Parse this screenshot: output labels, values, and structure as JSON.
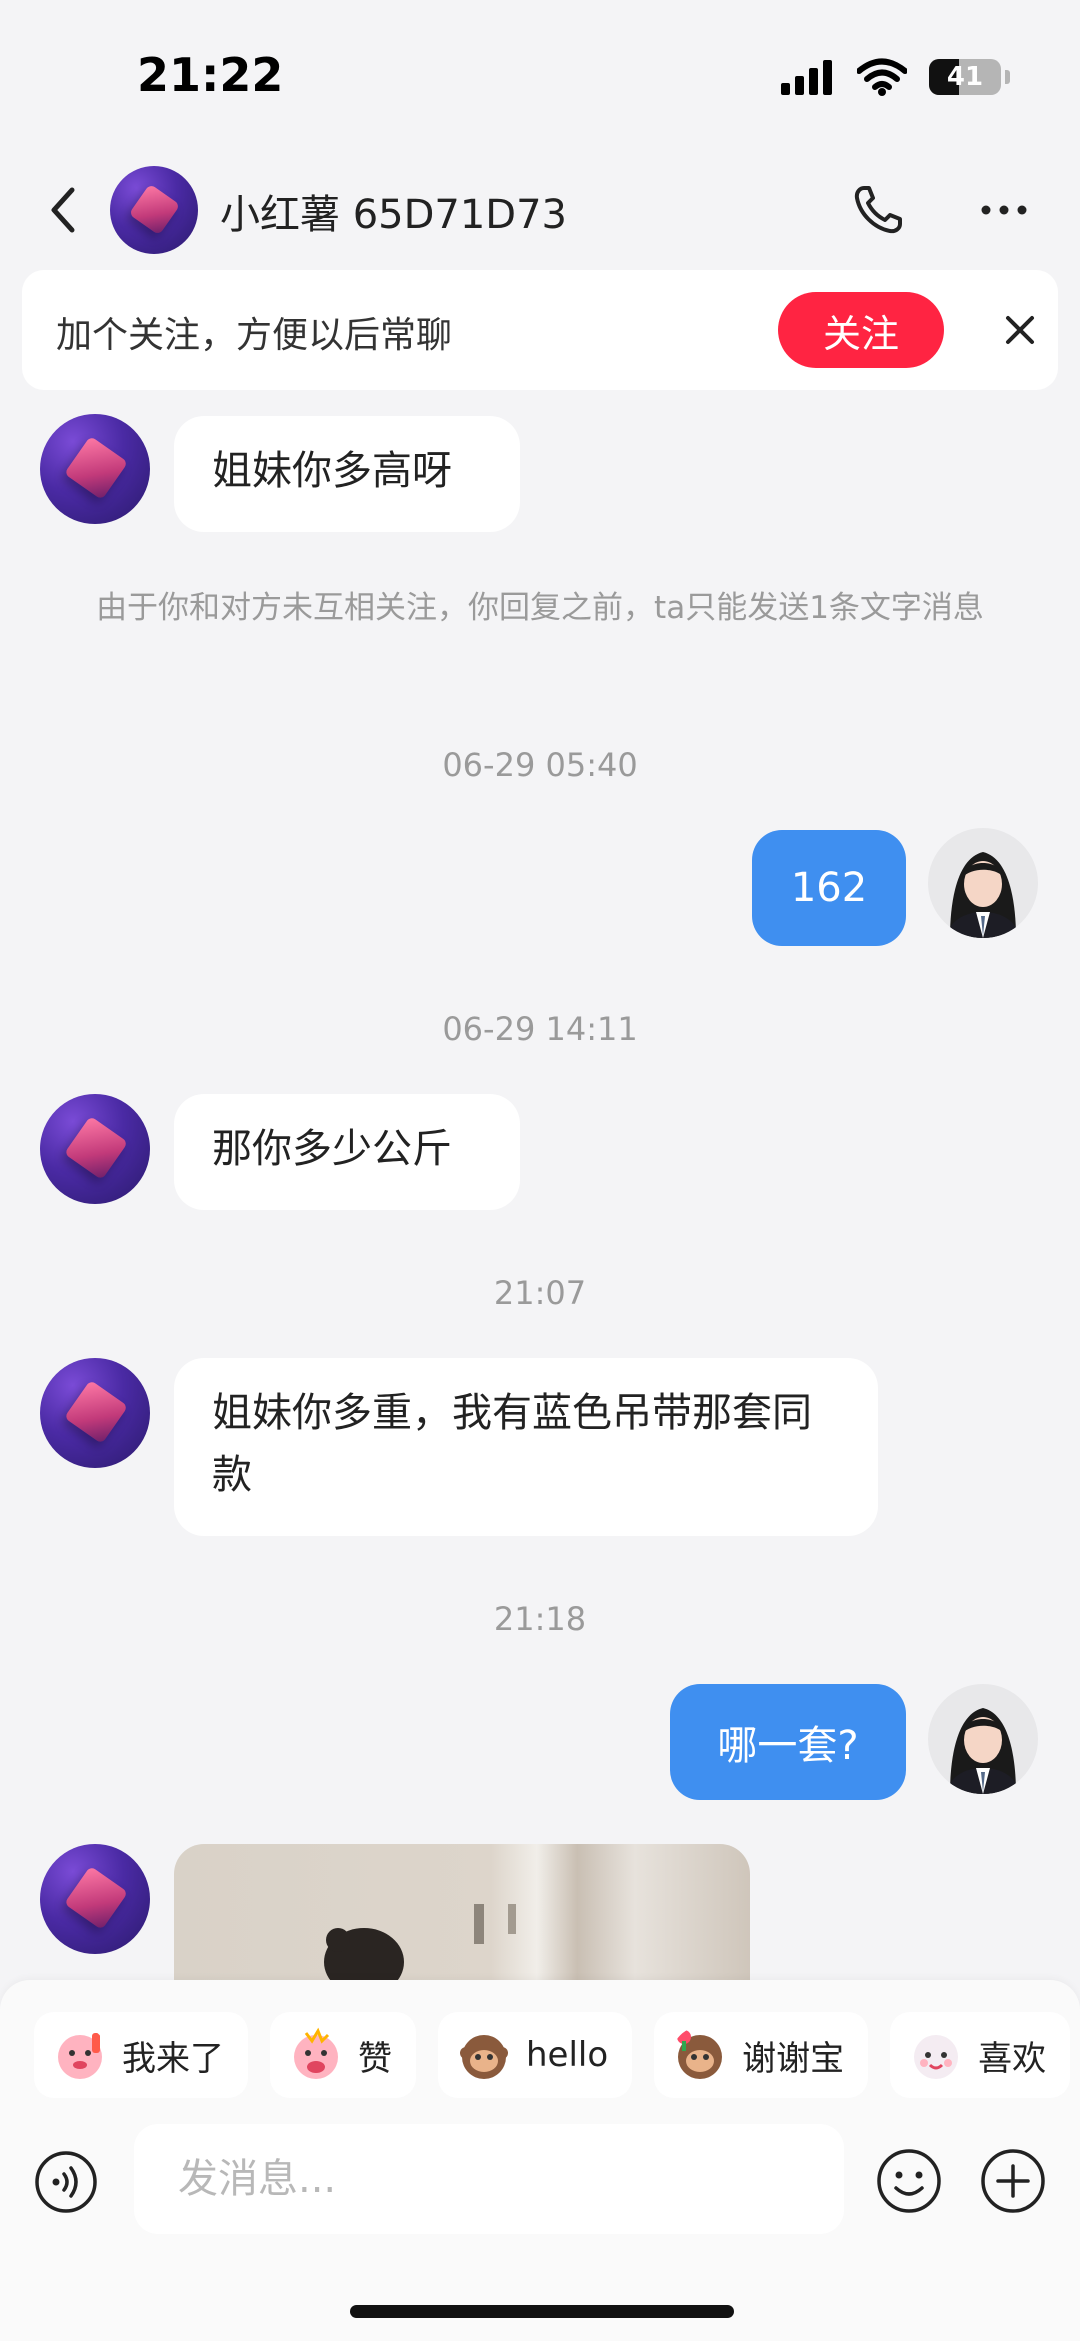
{
  "status_bar": {
    "time": "21:22",
    "battery": "41",
    "battery_level": 0.41
  },
  "header": {
    "title": "小红薯 65D71D73"
  },
  "banner": {
    "text": "加个关注，方便以后常聊",
    "follow_label": "关注"
  },
  "messages": {
    "m1": "姐妹你多高呀",
    "system_notice": "由于你和对方未互相关注，你回复之前，ta只能发送1条文字消息",
    "ts1": "06-29 05:40",
    "m2": "162",
    "ts2": "06-29 14:11",
    "m3": "那你多少公斤",
    "ts3": "21:07",
    "m4": "姐妹你多重，我有蓝色吊带那套同款",
    "ts4": "21:18",
    "m5": "哪一套?"
  },
  "quick_replies": [
    "我来了",
    "赞",
    "hello",
    "谢谢宝",
    "喜欢"
  ],
  "composer": {
    "placeholder": "发消息..."
  },
  "colors": {
    "accent_red": "#ff2442",
    "bubble_blue": "#3f8ff0"
  }
}
